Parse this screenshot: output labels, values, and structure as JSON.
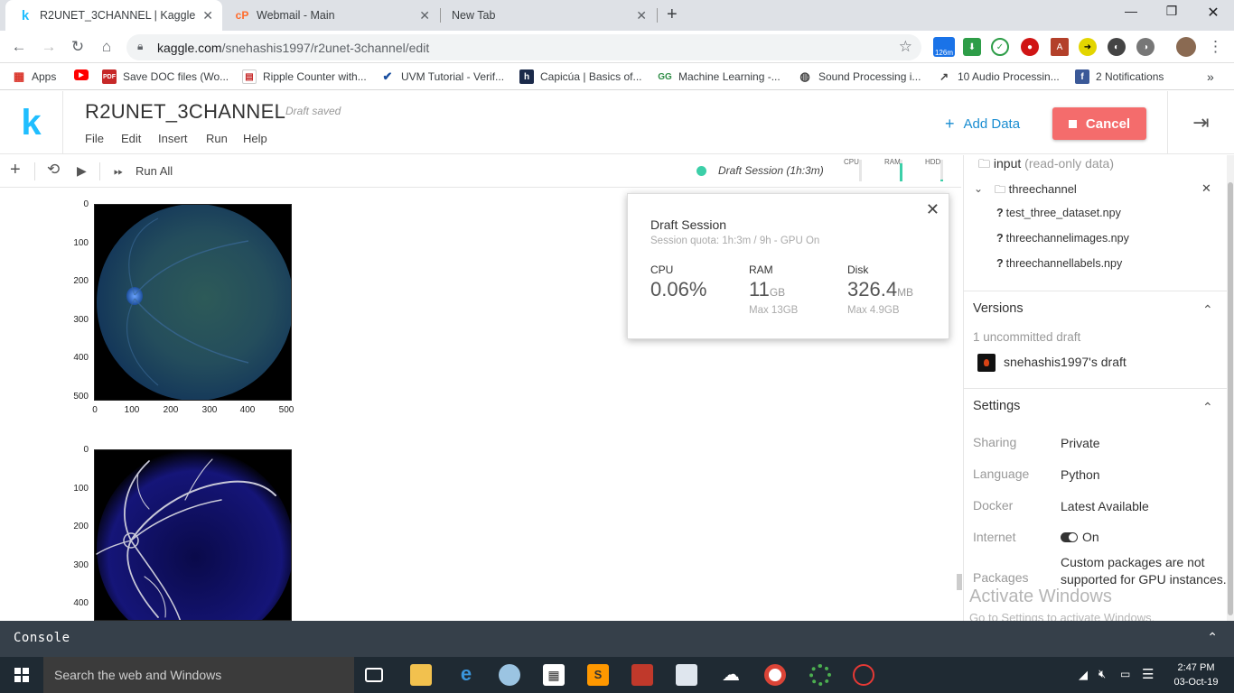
{
  "browser": {
    "tabs": [
      {
        "title": "R2UNET_3CHANNEL | Kaggle",
        "active": true
      },
      {
        "title": "Webmail - Main",
        "active": false
      },
      {
        "title": "New Tab",
        "active": false
      }
    ],
    "new_tab": "+",
    "window": {
      "minimize": "—",
      "maximize": "❐",
      "close": "✕"
    },
    "url_domain": "kaggle.com",
    "url_path": "/snehashis1997/r2unet-3channel/edit",
    "ext_badge": "126m",
    "bookmarks": [
      "Apps",
      "Save DOC files (Wo...",
      "Ripple Counter with...",
      "UVM Tutorial - Verif...",
      "Capicúa | Basics of...",
      "Machine Learning -...",
      "Sound Processing i...",
      "10 Audio Processin...",
      "2 Notifications"
    ],
    "bookmarks_more": "»"
  },
  "kaggle": {
    "logo": "k",
    "title": "R2UNET_3CHANNEL",
    "status": "Draft saved",
    "menu": [
      "File",
      "Edit",
      "Insert",
      "Run",
      "Help"
    ],
    "add_data": "Add Data",
    "cancel": "Cancel",
    "run_all": "Run All",
    "session_label": "Draft Session (1h:3m)",
    "meters": [
      {
        "label": "CPU",
        "level": 0.0
      },
      {
        "label": "RAM",
        "level": 0.85
      },
      {
        "label": "HDD",
        "level": 0.1
      }
    ]
  },
  "plots": [
    {
      "yticks": [
        "0",
        "100",
        "200",
        "300",
        "400",
        "500"
      ],
      "xticks": [
        "0",
        "100",
        "200",
        "300",
        "400",
        "500"
      ]
    },
    {
      "yticks": [
        "0",
        "100",
        "200",
        "300",
        "400"
      ]
    }
  ],
  "session_popup": {
    "title": "Draft Session",
    "quota": "Session quota: 1h:3m / 9h - GPU On",
    "cpu": {
      "label": "CPU",
      "value": "0.06%"
    },
    "ram": {
      "label": "RAM",
      "value": "11",
      "unit": "GB",
      "max": "Max 13GB"
    },
    "disk": {
      "label": "Disk",
      "value": "326.4",
      "unit": "MB",
      "max": "Max 4.9GB"
    }
  },
  "sidebar": {
    "input_label": "input",
    "input_note": "(read-only data)",
    "folder": "threechannel",
    "files": [
      "test_three_dataset.npy",
      "threechannelimages.npy",
      "threechannellabels.npy"
    ],
    "versions_title": "Versions",
    "uncommitted": "1 uncommitted draft",
    "draft_owner": "snehashis1997's draft",
    "settings_title": "Settings",
    "settings": [
      {
        "key": "Sharing",
        "value": "Private"
      },
      {
        "key": "Language",
        "value": "Python"
      },
      {
        "key": "Docker",
        "value": "Latest Available"
      },
      {
        "key": "Internet",
        "value": "On"
      },
      {
        "key": "Packages",
        "value": "Custom packages are not supported for GPU instances."
      }
    ]
  },
  "watermark": {
    "line1": "Activate Windows",
    "line2": "Go to Settings to activate Windows."
  },
  "console": {
    "label": "Console"
  },
  "taskbar": {
    "search": "Search the web and Windows",
    "time": "2:47 PM",
    "date": "03-Oct-19"
  }
}
